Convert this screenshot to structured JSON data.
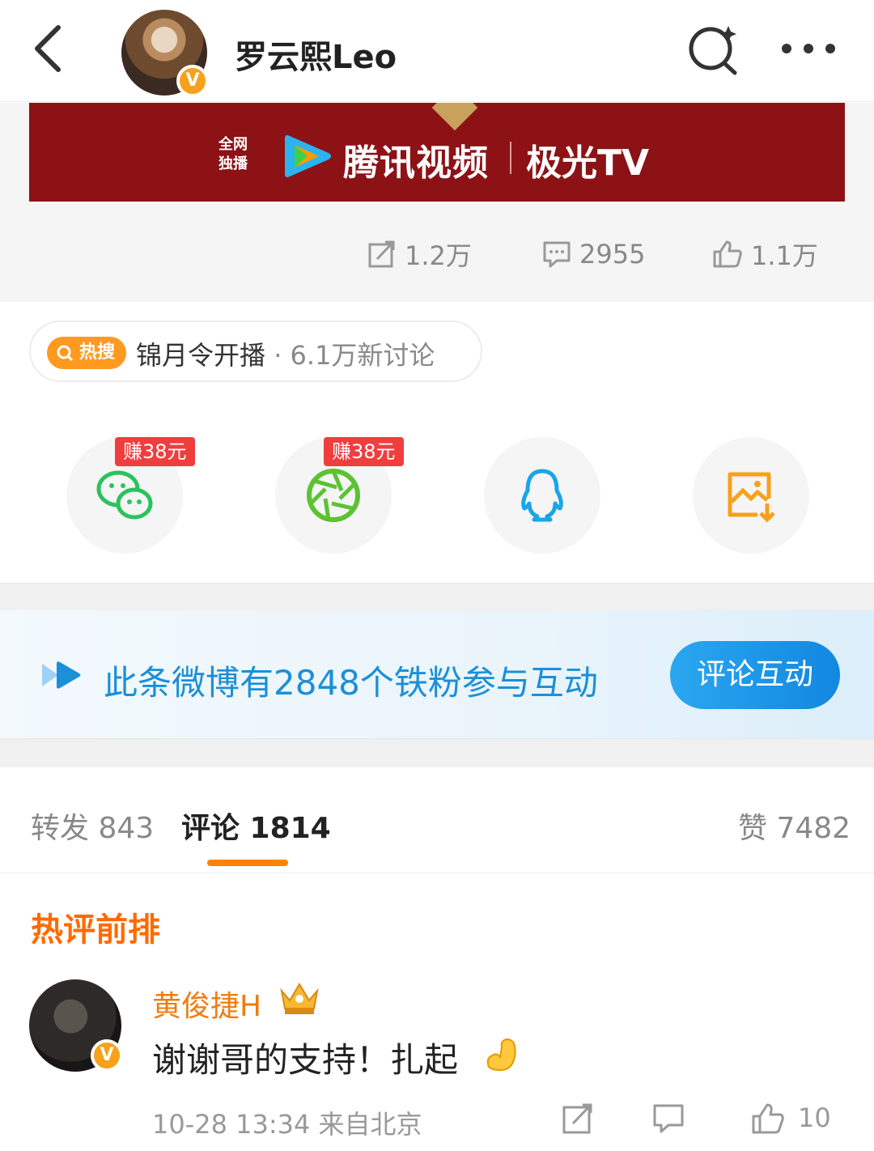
{
  "header": {
    "title": "罗云熙Leo",
    "back_icon": "back-arrow-icon",
    "search_icon": "search-icon",
    "more_icon": "more-icon",
    "verified_mark": "V"
  },
  "banner": {
    "small_text": "全网\n独播",
    "brand1": "腾讯视频",
    "brand2": "极光TV"
  },
  "post_actions": {
    "repost": "1.2万",
    "comment": "2955",
    "like": "1.1万"
  },
  "hot_search": {
    "badge": "热搜",
    "topic": "锦月令开播",
    "detail": " · 6.1万新讨论"
  },
  "share": {
    "wechat_reward": "赚38元",
    "moments_reward": "赚38元",
    "colors": {
      "wechat": "#2bc25e",
      "moments": "#5cc232",
      "qq": "#1aa5e8",
      "save": "#f7a11a"
    }
  },
  "fans_bar": {
    "text": "此条微博有2848个铁粉参与互动",
    "button": "评论互动"
  },
  "tabs": {
    "repost": "转发 843",
    "comment": "评论 1814",
    "like": "赞 7482"
  },
  "hot_comments": {
    "title": "热评前排",
    "items": [
      {
        "name": "黄俊捷H",
        "text": "谢谢哥的支持！扎起",
        "time": "10-28 13:34",
        "location": "来自北京",
        "likes": "10"
      }
    ]
  },
  "colors": {
    "accent": "#ff8200",
    "link_blue": "#1b8fd8",
    "hot_orange": "#ff6a00"
  }
}
